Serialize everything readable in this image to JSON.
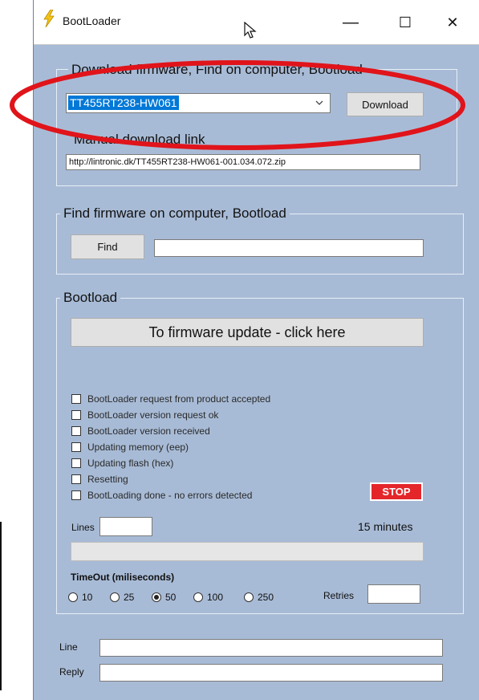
{
  "window": {
    "title": "BootLoader",
    "minimize": "—",
    "maximize": "☐",
    "close": "✕"
  },
  "download_group": {
    "legend": "Download firmware, Find on computer, Bootload",
    "selected_firmware": "TT455RT238-HW061",
    "download_button": "Download",
    "manual_link_label": "Manual download link",
    "manual_link_value": "http://lintronic.dk/TT455RT238-HW061-001.034.072.zip"
  },
  "find_group": {
    "legend": "Find firmware on computer, Bootload",
    "find_button": "Find",
    "path_value": ""
  },
  "bootload_group": {
    "legend": "Bootload",
    "update_button": "To firmware update - click here",
    "steps": [
      "BootLoader request from product accepted",
      "BootLoader version request ok",
      "BootLoader version received",
      "Updating memory (eep)",
      "Updating flash (hex)",
      "Resetting",
      "BootLoading done - no errors detected"
    ],
    "stop_button": "STOP",
    "lines_label": "Lines",
    "lines_value": "",
    "duration_text": "15 minutes",
    "progress": 0,
    "timeout_label": "TimeOut (miliseconds)",
    "timeout_options": [
      "10",
      "25",
      "50",
      "100",
      "250"
    ],
    "timeout_selected": "50",
    "retries_label": "Retries",
    "retries_value": ""
  },
  "bottom": {
    "line_label": "Line",
    "line_value": "",
    "reply_label": "Reply",
    "reply_value": ""
  },
  "colors": {
    "window_bg": "#a8bbd6",
    "stop_red": "#e4262b",
    "selection_blue": "#0078d7",
    "annotation_red": "#e0141a"
  },
  "icons": {
    "app": "lightning-bolt-icon",
    "cursor": "mouse-pointer-icon"
  }
}
